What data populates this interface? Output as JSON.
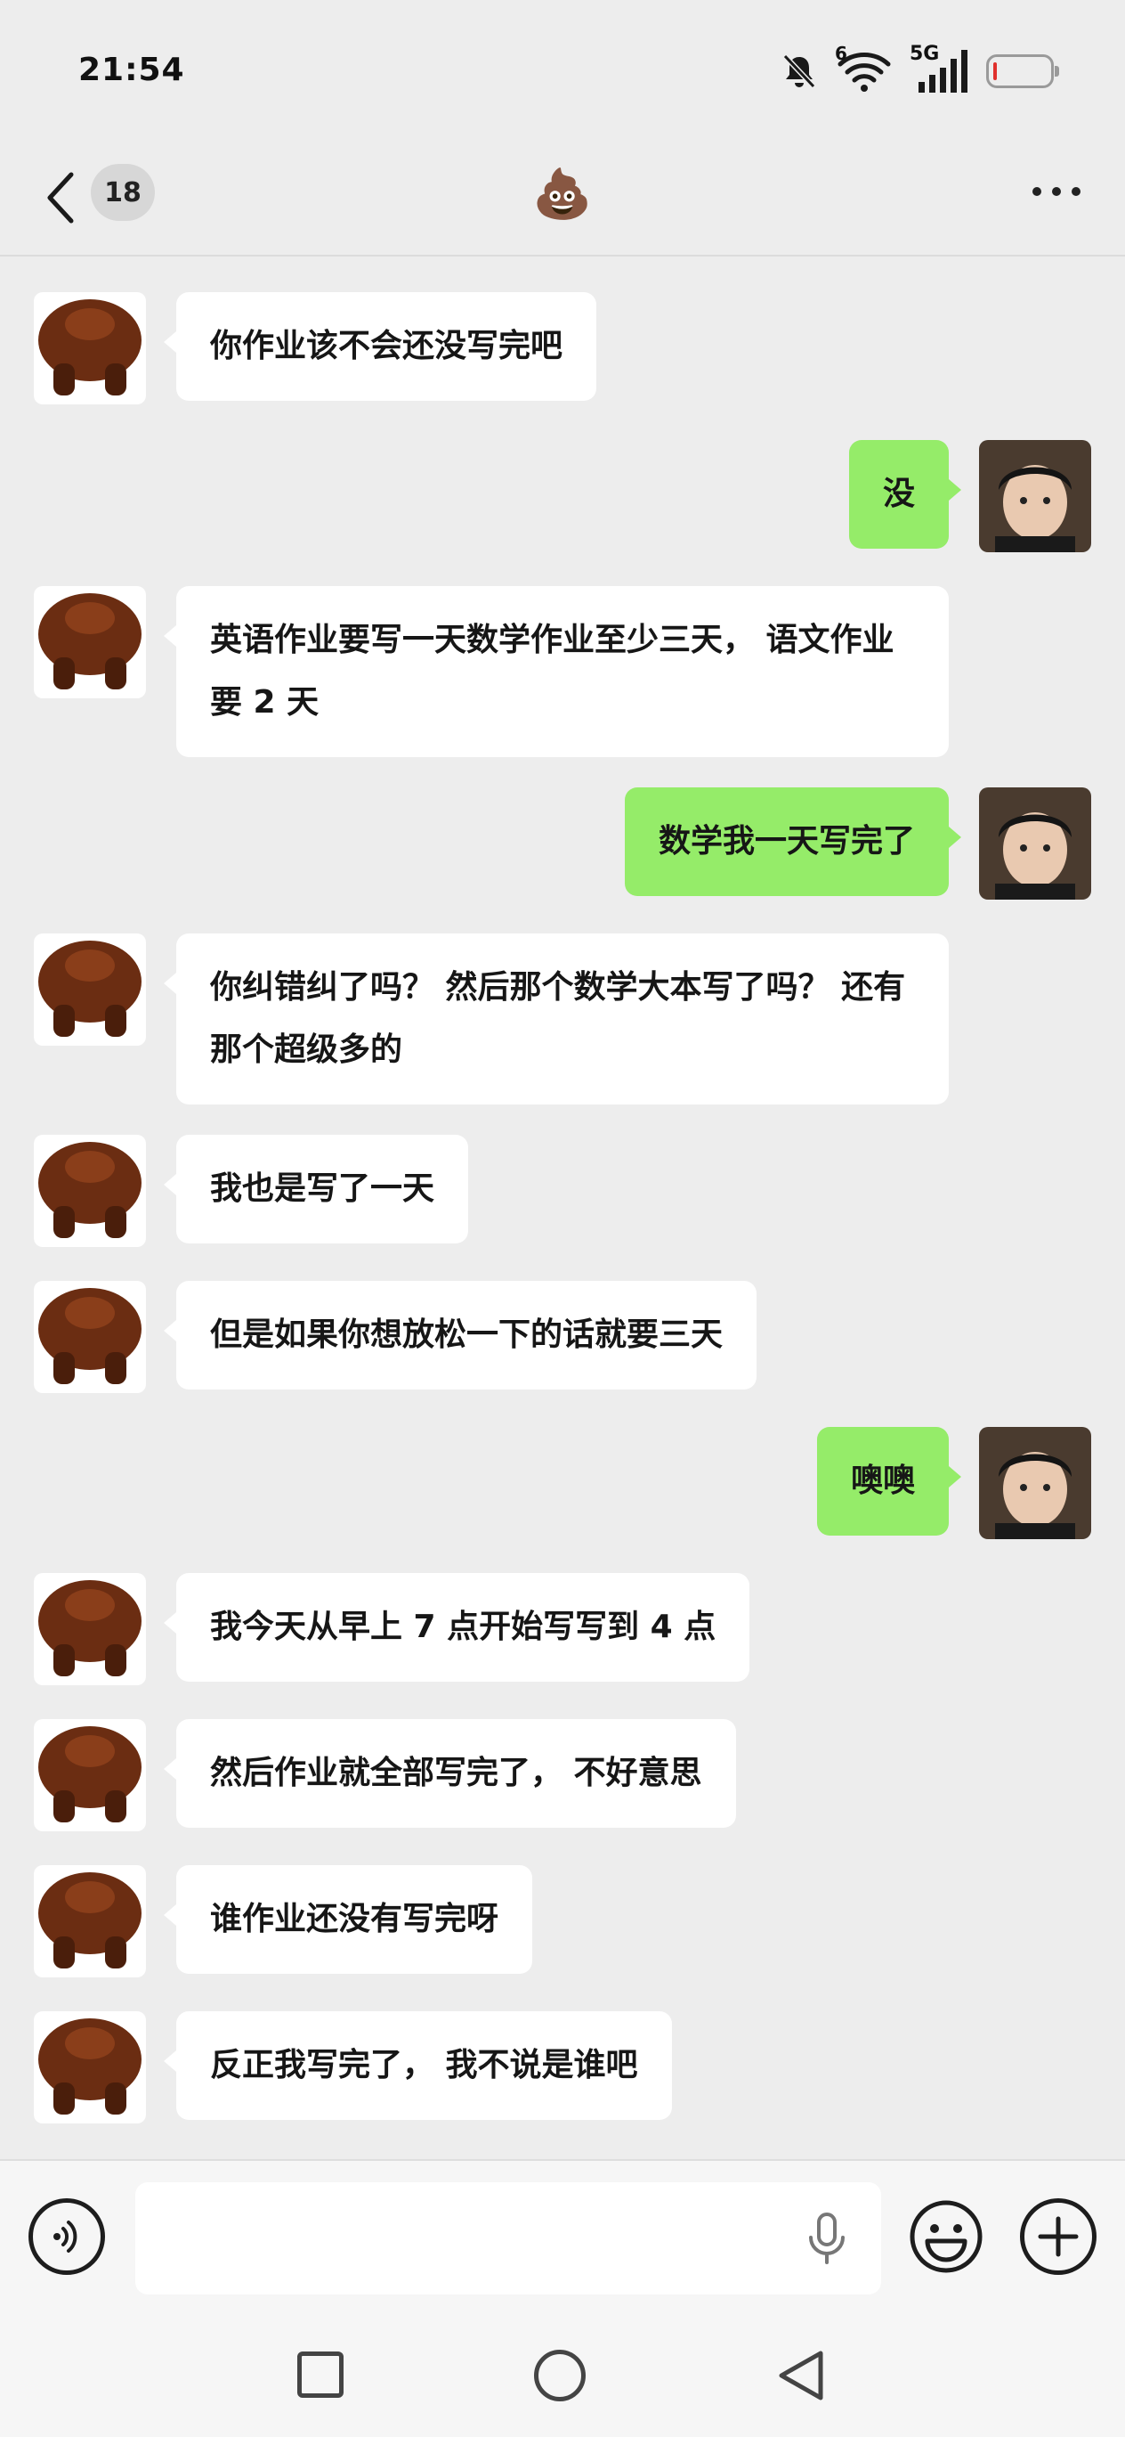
{
  "status_bar": {
    "time": "21:54",
    "icons": [
      "bell-muted-icon",
      "wifi-icon",
      "signal-5g-icon",
      "battery-low-icon"
    ],
    "network_label": "5G",
    "wifi_label": "6",
    "battery_level": 0.05,
    "battery_color": "#e0302c"
  },
  "header": {
    "unread_count": "18",
    "title": "💩"
  },
  "colors": {
    "background": "#ededed",
    "incoming_bubble": "#ffffff",
    "outgoing_bubble": "#95ec69"
  },
  "messages": [
    {
      "side": "left",
      "text": "你作业该不会还没写完吧"
    },
    {
      "side": "right",
      "text": "没"
    },
    {
      "side": "left",
      "text": "英语作业要写一天数学作业至少三天， 语文作业要 2 天"
    },
    {
      "side": "right",
      "text": "数学我一天写完了"
    },
    {
      "side": "left",
      "text": "你纠错纠了吗？ 然后那个数学大本写了吗？ 还有那个超级多的"
    },
    {
      "side": "left",
      "text": "我也是写了一天"
    },
    {
      "side": "left",
      "text": "但是如果你想放松一下的话就要三天"
    },
    {
      "side": "right",
      "text": "噢噢"
    },
    {
      "side": "left",
      "text": "我今天从早上 7 点开始写写到 4 点"
    },
    {
      "side": "left",
      "text": "然后作业就全部写完了， 不好意思"
    },
    {
      "side": "left",
      "text": "谁作业还没有写完呀"
    },
    {
      "side": "left",
      "text": "反正我写完了， 我不说是谁吧"
    }
  ],
  "input_bar": {
    "placeholder": "",
    "icons": [
      "voice-icon",
      "mic-icon",
      "emoji-icon",
      "plus-icon"
    ]
  },
  "nav_bar": {
    "icons": [
      "recent-apps-icon",
      "home-icon",
      "back-icon"
    ]
  }
}
